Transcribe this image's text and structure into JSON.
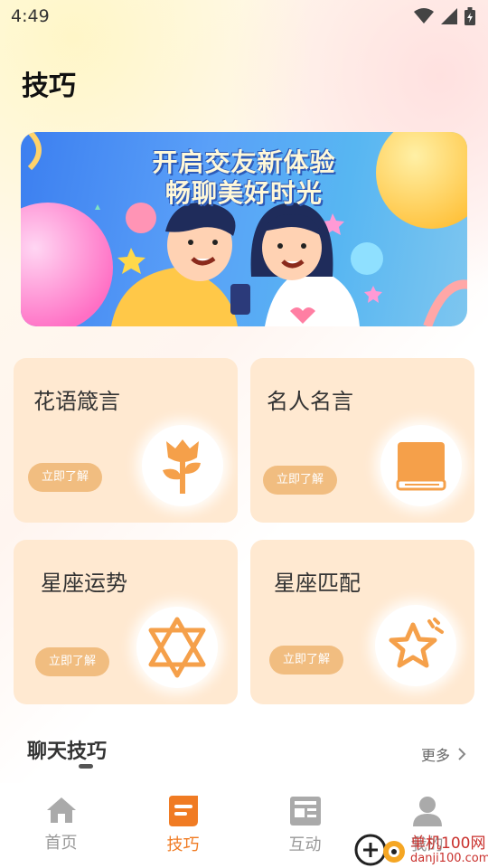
{
  "status_bar": {
    "time": "4:49"
  },
  "page": {
    "title": "技巧"
  },
  "banner": {
    "line1": "开启交友新体验",
    "line2": "畅聊美好时光"
  },
  "cards": [
    {
      "title": "花语箴言",
      "button": "立即了解",
      "icon": "flower-icon"
    },
    {
      "title": "名人名言",
      "button": "立即了解",
      "icon": "book-icon"
    },
    {
      "title": "星座运势",
      "button": "立即了解",
      "icon": "hexagram-icon"
    },
    {
      "title": "星座匹配",
      "button": "立即了解",
      "icon": "star-icon"
    }
  ],
  "section": {
    "title": "聊天技巧",
    "more": "更多"
  },
  "tabs": [
    {
      "label": "首页",
      "icon": "home-icon",
      "active": false
    },
    {
      "label": "技巧",
      "icon": "tips-icon",
      "active": true
    },
    {
      "label": "互动",
      "icon": "news-icon",
      "active": false
    },
    {
      "label": "我的",
      "icon": "user-icon",
      "active": false
    }
  ],
  "watermark": {
    "text": "单机100网",
    "url": "danji100.com"
  },
  "colors": {
    "accent": "#f07b23",
    "card_bg": "#ffe9d1",
    "card_button": "#f1bd80",
    "icon_orange": "#f5a04a"
  }
}
